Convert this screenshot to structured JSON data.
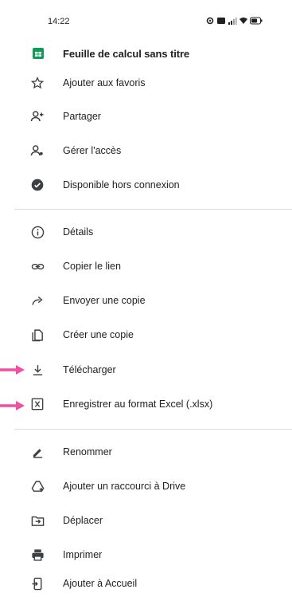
{
  "status_bar": {
    "time": "14:22"
  },
  "header": {
    "title": "Feuille de calcul sans titre",
    "icon": "sheets-icon"
  },
  "menu": {
    "favorites": "Ajouter aux favoris",
    "share": "Partager",
    "manage_access": "Gérer l'accès",
    "offline": "Disponible hors connexion",
    "details": "Détails",
    "copy_link": "Copier le lien",
    "send_copy": "Envoyer une copie",
    "make_copy": "Créer une copie",
    "download": "Télécharger",
    "save_excel": "Enregistrer au format Excel (.xlsx)",
    "rename": "Renommer",
    "add_shortcut": "Ajouter un raccourci à Drive",
    "move": "Déplacer",
    "print": "Imprimer",
    "add_home": "Ajouter à Accueil"
  },
  "colors": {
    "sheets_green": "#0f9d58",
    "arrow_pink": "#f04fa3",
    "icon_gray": "#3c4043",
    "divider": "#dadce0"
  }
}
